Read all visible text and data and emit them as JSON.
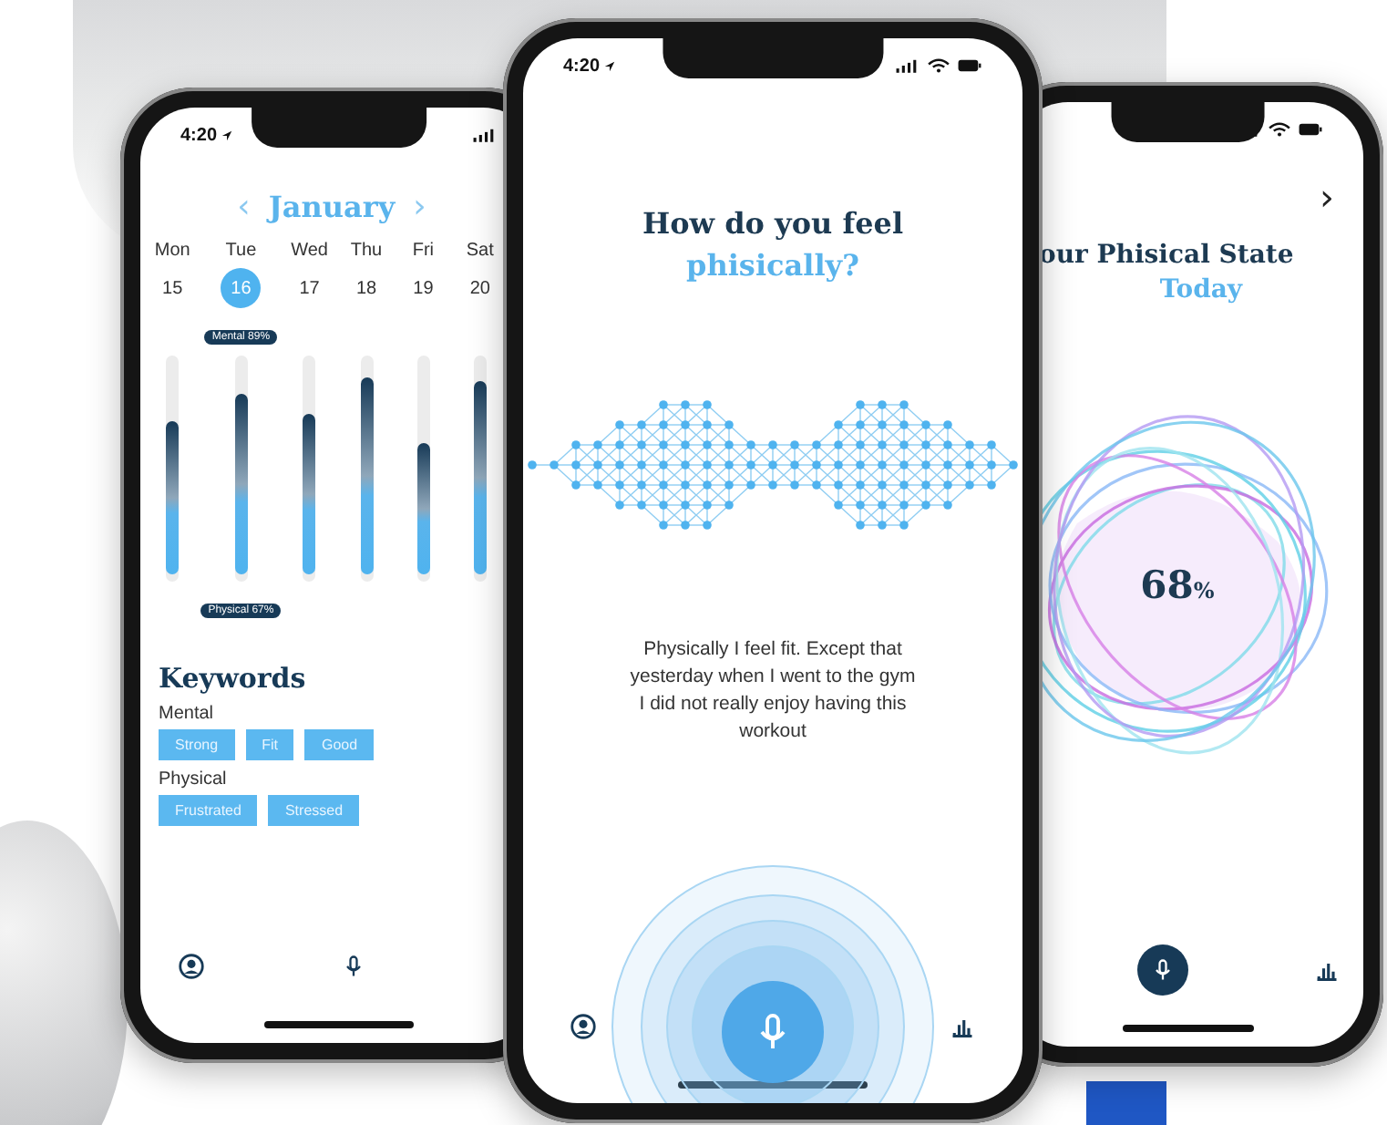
{
  "phones": [
    {
      "kind": "calendar",
      "time": "4:20",
      "month": {
        "prev": "‹",
        "label": "January",
        "next": "›"
      },
      "days": [
        {
          "name": "Mon",
          "date": "15",
          "selected": false,
          "level": 0.72
        },
        {
          "name": "Tue",
          "date": "16",
          "selected": true,
          "level": 0.85
        },
        {
          "name": "Wed",
          "date": "17",
          "selected": false,
          "level": 0.76
        },
        {
          "name": "Thu",
          "date": "18",
          "selected": false,
          "level": 0.93
        },
        {
          "name": "Fri",
          "date": "19",
          "selected": false,
          "level": 0.62
        },
        {
          "name": "Sat",
          "date": "20",
          "selected": false,
          "level": 0.91
        }
      ],
      "mental_badge": "Mental 89%",
      "physical_badge": "Physical 67%",
      "keywords": {
        "title": "Keywords",
        "groups": [
          {
            "label": "Mental",
            "tags": [
              "Strong",
              "Fit",
              "Good"
            ]
          },
          {
            "label": "Physical",
            "tags": [
              "Frustrated",
              "Stressed"
            ]
          }
        ]
      },
      "nav": [
        {
          "kind": "profile",
          "selected": false
        },
        {
          "kind": "mic",
          "selected": false
        }
      ]
    },
    {
      "kind": "voice",
      "time": "4:20",
      "title": "How do you feel",
      "subtitle": "phisically?",
      "transcript": "Physically I feel fit. Except that yesterday when I went to the gym I did not really enjoy having this workout",
      "nav": [
        {
          "kind": "profile",
          "selected": false
        },
        {
          "kind": "record",
          "selected": true
        },
        {
          "kind": "chart",
          "selected": false
        }
      ]
    },
    {
      "kind": "state",
      "next": "›",
      "title": "our Phisical State",
      "subtitle": "Today",
      "value": "68",
      "unit": "%",
      "nav": [
        {
          "kind": "mic",
          "selected": true
        },
        {
          "kind": "chart",
          "selected": false
        }
      ]
    }
  ]
}
